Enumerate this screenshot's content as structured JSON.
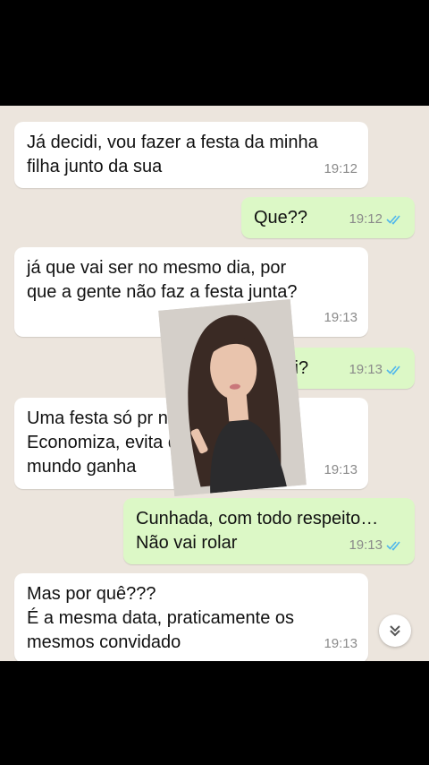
{
  "messages": [
    {
      "dir": "in",
      "text": "Já decidi, vou fazer a festa da minha\nfilha junto da sua",
      "time": "19:12"
    },
    {
      "dir": "out",
      "text": "Que??",
      "time": "19:12",
      "read": true
    },
    {
      "dir": "in",
      "text": "já que vai ser no mesmo dia, por\nque a gente não faz a festa junta?",
      "time": "19:13"
    },
    {
      "dir": "out",
      "text": "Oi?",
      "time": "19:13",
      "read": true
    },
    {
      "dir": "in",
      "text": "Uma festa só pr            nas\nEconomiza, evita              do\nmundo ganha",
      "time": "19:13"
    },
    {
      "dir": "out",
      "text": "Cunhada, com todo respeito…\nNão vai rolar",
      "time": "19:13",
      "read": true
    },
    {
      "dir": "in",
      "text": "Mas por quê???\nÉ a mesma data, praticamente os\nmesmos convidado",
      "time": "19:13"
    }
  ],
  "colors": {
    "incoming": "#ffffff",
    "outgoing": "#dcf8c6",
    "background": "#ece5dd",
    "read_ticks": "#4fb6ec"
  },
  "icons": {
    "read_receipt": "double-check-icon",
    "scroll": "chevron-double-down-icon"
  }
}
